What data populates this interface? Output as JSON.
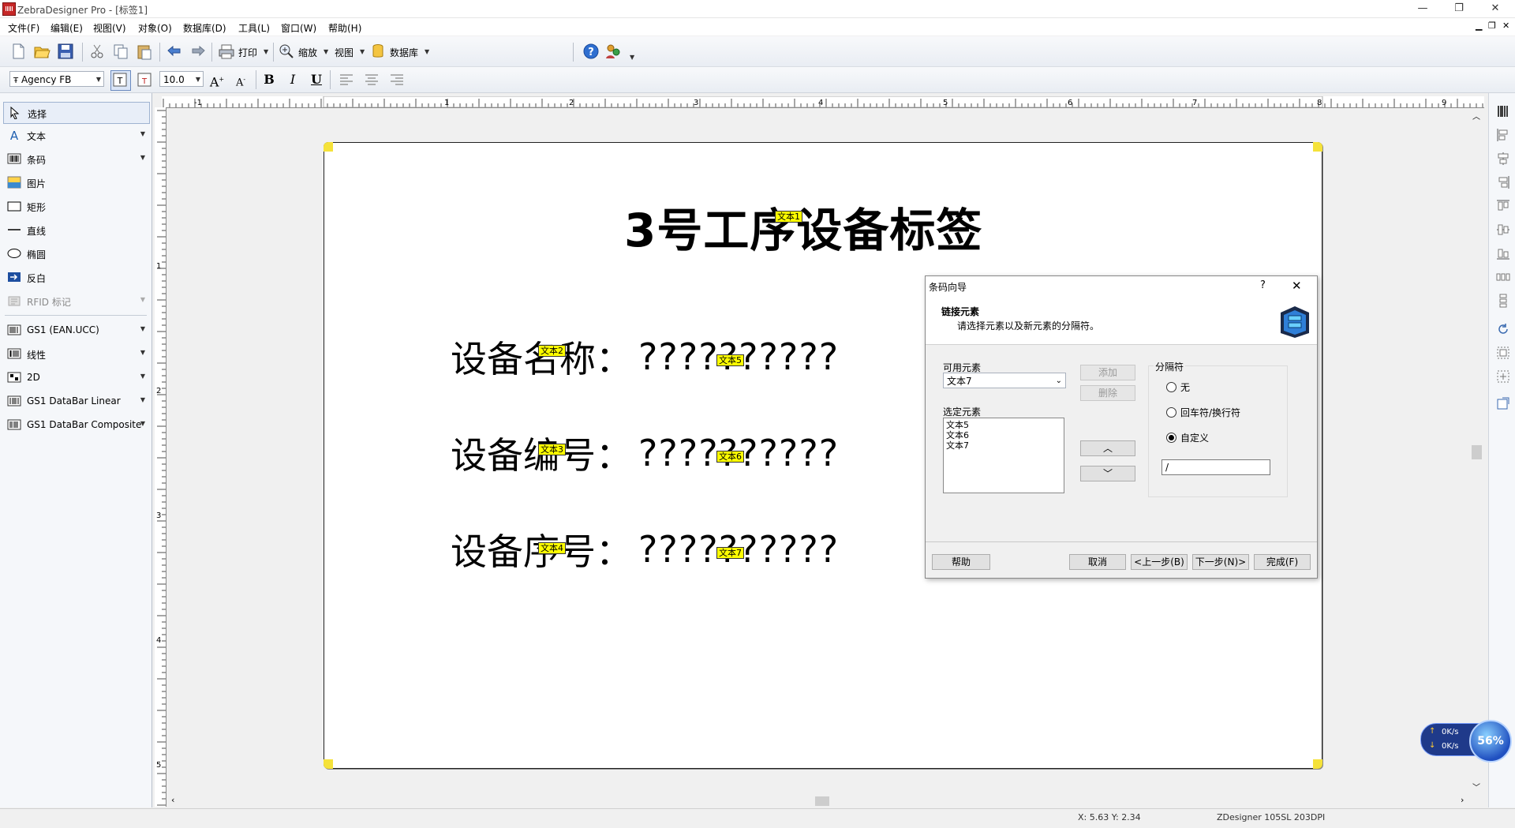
{
  "window": {
    "title": "ZebraDesigner Pro - [标签1]",
    "minimize": "—",
    "restore": "❐",
    "close": "✕",
    "mdi_minimize": "▁",
    "mdi_restore": "❐",
    "mdi_close": "✕"
  },
  "menu": [
    "文件(F)",
    "编辑(E)",
    "视图(V)",
    "对象(O)",
    "数据库(D)",
    "工具(L)",
    "窗口(W)",
    "帮助(H)"
  ],
  "toolbar": {
    "print": "打印",
    "zoom": "缩放",
    "view": "视图",
    "database": "数据库"
  },
  "format": {
    "font": "Agency FB",
    "size": "10.0",
    "bold": "B",
    "italic": "I",
    "underline": "U"
  },
  "toolbox": {
    "items": [
      "选择",
      "文本",
      "条码",
      "图片",
      "矩形",
      "直线",
      "椭圆",
      "反白",
      "RFID 标记"
    ],
    "barcode_groups": [
      "GS1 (EAN.UCC)",
      "线性",
      "2D",
      "GS1 DataBar Linear",
      "GS1 DataBar Composite"
    ]
  },
  "ruler": {
    "h": [
      "-1",
      "1",
      "2",
      "3",
      "4",
      "5",
      "6",
      "7",
      "8",
      "9"
    ],
    "v": [
      "1",
      "2",
      "3",
      "4",
      "5"
    ]
  },
  "label": {
    "title": "3号工序设备标签",
    "title_tag": "文本1",
    "rows": [
      {
        "label": "设备名称：",
        "value": "??????????",
        "label_tag": "文本2",
        "value_tag": "文本5"
      },
      {
        "label": "设备编号：",
        "value": "??????????",
        "label_tag": "文本3",
        "value_tag": "文本6"
      },
      {
        "label": "设备序号：",
        "value": "??????????",
        "label_tag": "文本4",
        "value_tag": "文本7"
      }
    ]
  },
  "dialog": {
    "title": "条码向导",
    "help_glyph": "?",
    "close_glyph": "✕",
    "heading": "链接元素",
    "subheading": "请选择元素以及新元素的分隔符。",
    "available_label": "可用元素",
    "available_value": "文本7",
    "selected_label": "选定元素",
    "selected_items": [
      "文本5",
      "文本6",
      "文本7"
    ],
    "add": "添加",
    "delete": "删除",
    "up": "︿",
    "down": "﹀",
    "separator_label": "分隔符",
    "separator_options": [
      "无",
      "回车符/换行符",
      "自定义"
    ],
    "separator_selected": 2,
    "custom_value": "/",
    "buttons": {
      "help": "帮助",
      "cancel": "取消",
      "back": "<上一步(B)",
      "next": "下一步(N)>",
      "finish": "完成(F)"
    }
  },
  "status": {
    "coords": "X: 5.63 Y: 2.34",
    "printer": "ZDesigner 105SL 203DPI"
  },
  "net_widget": {
    "percent": "56%",
    "up": "0K/s",
    "down": "0K/s"
  }
}
